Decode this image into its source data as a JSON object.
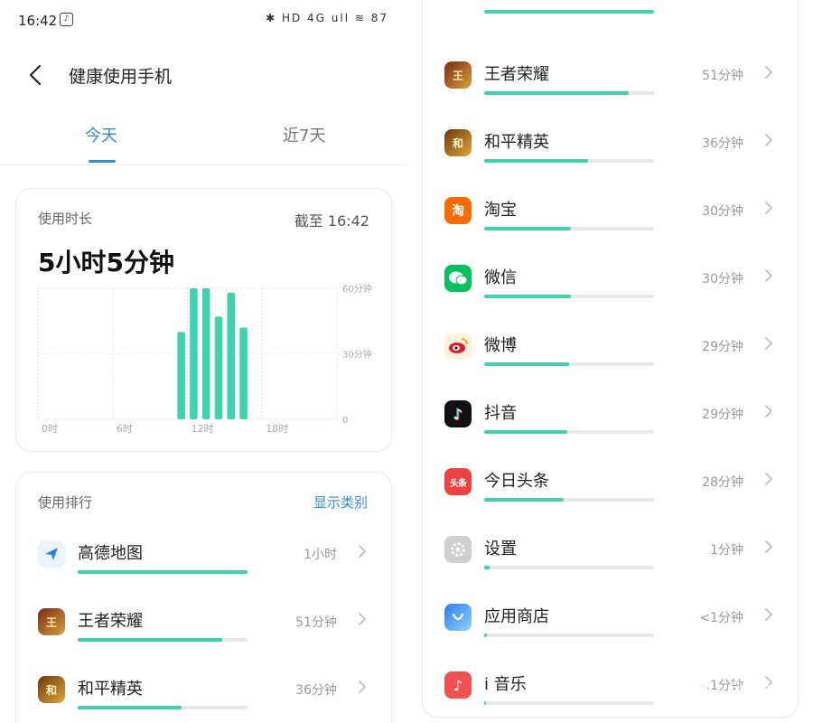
{
  "status_bar": {
    "time": "16:42",
    "icons": "✱ HD 4G ull ≋ 87"
  },
  "header": {
    "title": "健康使用手机"
  },
  "tabs": [
    {
      "label": "今天",
      "active": true
    },
    {
      "label": "近7天",
      "active": false
    }
  ],
  "usage": {
    "label": "使用时长",
    "as_of": "截至 16:42",
    "total": "5小时5分钟"
  },
  "chart_data": {
    "type": "bar",
    "x_unit": "hour",
    "x": [
      11,
      12,
      13,
      14,
      15,
      16
    ],
    "values": [
      40,
      60,
      60,
      47,
      58,
      42
    ],
    "xticks": [
      "0时",
      "6时",
      "12时",
      "18时"
    ],
    "yticks": [
      "60分钟",
      "30分钟",
      "0"
    ],
    "xlim": [
      0,
      24
    ],
    "ylim": [
      0,
      60
    ],
    "color": "#3ed3ad",
    "grid": true
  },
  "ranking": {
    "label": "使用排行",
    "link": "显示类别",
    "left_items": [
      {
        "name": "高德地图",
        "duration": "1小时",
        "fraction": 1.0,
        "icon": "amap-icon"
      },
      {
        "name": "王者荣耀",
        "duration": "51分钟",
        "fraction": 0.85,
        "icon": "honor-of-kings-icon"
      },
      {
        "name": "和平精英",
        "duration": "36分钟",
        "fraction": 0.61,
        "icon": "peace-elite-icon"
      }
    ],
    "right_items": [
      {
        "name": "王者荣耀",
        "duration": "51分钟",
        "fraction": 0.85,
        "icon": "honor-of-kings-icon"
      },
      {
        "name": "和平精英",
        "duration": "36分钟",
        "fraction": 0.61,
        "icon": "peace-elite-icon"
      },
      {
        "name": "淘宝",
        "duration": "30分钟",
        "fraction": 0.51,
        "icon": "taobao-icon"
      },
      {
        "name": "微信",
        "duration": "30分钟",
        "fraction": 0.51,
        "icon": "wechat-icon"
      },
      {
        "name": "微博",
        "duration": "29分钟",
        "fraction": 0.5,
        "icon": "weibo-icon"
      },
      {
        "name": "抖音",
        "duration": "29分钟",
        "fraction": 0.49,
        "icon": "douyin-icon"
      },
      {
        "name": "今日头条",
        "duration": "28分钟",
        "fraction": 0.47,
        "icon": "toutiao-icon"
      },
      {
        "name": "设置",
        "duration": "1分钟",
        "fraction": 0.03,
        "icon": "settings-icon"
      },
      {
        "name": "应用商店",
        "duration": "<1分钟",
        "fraction": 0.015,
        "icon": "app-store-icon"
      },
      {
        "name": "i 音乐",
        "duration": "<1分钟",
        "fraction": 0.012,
        "icon": "i-music-icon"
      }
    ]
  },
  "watermark": {
    "text": "钛媒体"
  },
  "colors": {
    "accent": "#2f8cd9",
    "bar": "#3ed3ad",
    "track": "#e8e8e8"
  }
}
